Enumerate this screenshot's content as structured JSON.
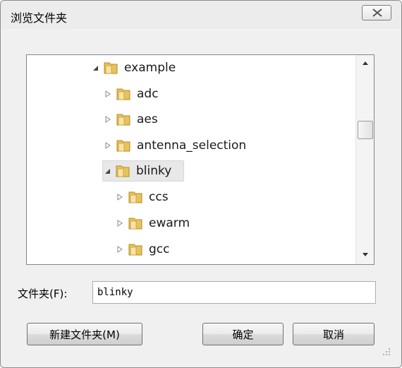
{
  "window": {
    "title": "浏览文件夹"
  },
  "tree": {
    "nodes": [
      {
        "label": "example",
        "expanded": true
      },
      {
        "label": "adc",
        "expanded": false
      },
      {
        "label": "aes",
        "expanded": false
      },
      {
        "label": "antenna_selection",
        "expanded": false
      },
      {
        "label": "blinky",
        "expanded": true,
        "selected": true
      },
      {
        "label": "ccs",
        "expanded": false
      },
      {
        "label": "ewarm",
        "expanded": false
      },
      {
        "label": "gcc",
        "expanded": false
      }
    ]
  },
  "folder_field": {
    "label": "文件夹(F):",
    "value": "blinky"
  },
  "buttons": {
    "new_folder": "新建文件夹(M)",
    "ok": "确定",
    "cancel": "取消"
  },
  "colors": {
    "dialog_bg": "#f0f0f0",
    "selection_bg": "#e8e8e8",
    "folder": "#e7c35b"
  }
}
